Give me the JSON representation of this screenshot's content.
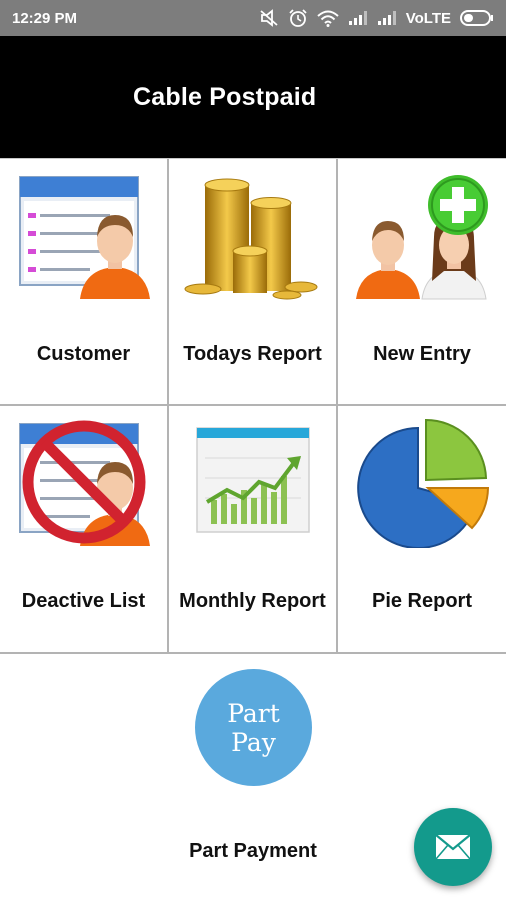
{
  "status_bar": {
    "time": "12:29 PM",
    "network": "VoLTE",
    "icons": [
      "mute-icon",
      "alarm-icon",
      "wifi-icon",
      "signal-icon",
      "signal-icon",
      "battery-icon"
    ]
  },
  "app_bar": {
    "title": "Cable Postpaid"
  },
  "tiles": [
    {
      "label": "Customer",
      "icon": "customer-card-icon"
    },
    {
      "label": "Todays Report",
      "icon": "coin-stack-icon"
    },
    {
      "label": "New Entry",
      "icon": "add-users-icon"
    },
    {
      "label": "Deactive List",
      "icon": "blocked-customer-icon"
    },
    {
      "label": "Monthly Report",
      "icon": "line-chart-icon"
    },
    {
      "label": "Pie Report",
      "icon": "pie-chart-icon"
    }
  ],
  "part_payment": {
    "label": "Part Payment",
    "icon_text_line1": "Part",
    "icon_text_line2": "Pay",
    "icon_color": "#5aa9dd"
  },
  "fab": {
    "icon": "mail-icon",
    "color": "#139a8c"
  }
}
